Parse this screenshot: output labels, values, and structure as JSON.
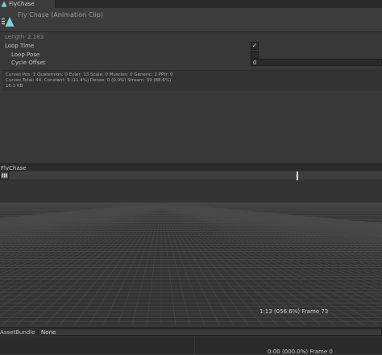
{
  "top_tab": {
    "label": "FlyChase",
    "icon": "animation-clip-icon"
  },
  "header": {
    "title": "Fly Chase (Animation Clip)",
    "icon": "animation-clip-icon"
  },
  "properties": {
    "length_label": "Length",
    "length_value": "2.183",
    "loop_time_label": "Loop Time",
    "loop_time_checked": "✓",
    "loop_pose_label": "Loop Pose",
    "cycle_offset_label": "Cycle Offset",
    "cycle_offset_value": "0"
  },
  "info": {
    "line1": "Curves Pos: 1 Quaternion: 0 Euler: 13 Scale: 0 Muscles: 0 Generic: 2 PPtr: 0",
    "line2": "Curves Total: 44, Constant: 5 (11.4%) Dense: 0 (0.0%) Stream: 39 (88.6%)",
    "line3": "16.1 KB"
  },
  "preview": {
    "title": "FlyChase",
    "play_icon": "pause-icon",
    "frame_label": "1:13 (056.6%) Frame 73"
  },
  "assetbundle": {
    "label": "AssetBundle",
    "value": "None"
  },
  "bottom": {
    "label": "0:00 (000.0%) Frame 0"
  },
  "colors": {
    "accent": "#7fd4d8",
    "background": "#383838",
    "grid_line": "#4a4a4a"
  }
}
